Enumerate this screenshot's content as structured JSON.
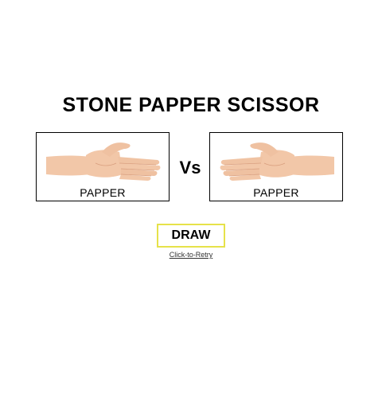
{
  "game": {
    "title": "STONE PAPPER SCISSOR",
    "vs_label": "Vs",
    "player_choice": {
      "label": "PAPPER",
      "icon": "open-hand-icon"
    },
    "computer_choice": {
      "label": "PAPPER",
      "icon": "open-hand-icon"
    },
    "result": "DRAW",
    "retry_link": "Click-to-Retry"
  },
  "colors": {
    "result_border": "#e6e24a",
    "skin": "#f2c7a8",
    "skin_shade": "#d99f7f"
  }
}
